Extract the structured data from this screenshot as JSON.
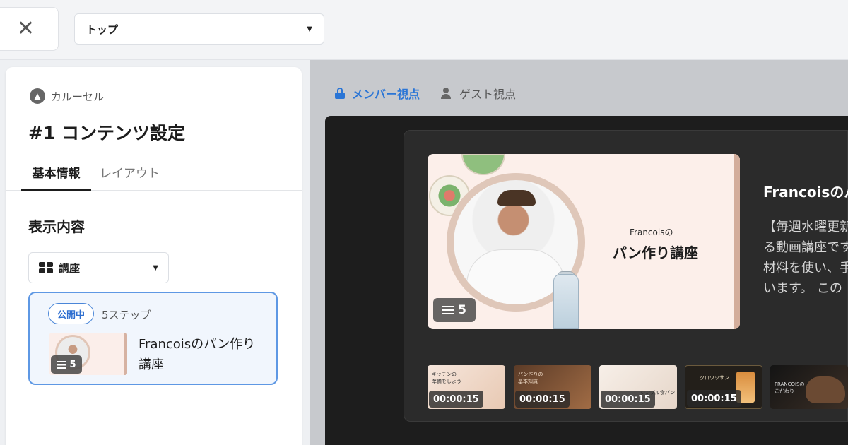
{
  "top_bar": {
    "close_label": "✕",
    "page_select_value": "トップ"
  },
  "panel": {
    "crumb": "カルーセル",
    "title": "#1 コンテンツ設定",
    "tabs": [
      {
        "label": "基本情報",
        "active": true
      },
      {
        "label": "レイアウト",
        "active": false
      }
    ],
    "section_title": "表示内容",
    "content_type": "講座",
    "course": {
      "status_badge": "公開中",
      "steps": "5ステップ",
      "title": "Francoisのパン作り講座",
      "count": "5"
    }
  },
  "preview": {
    "member_view": "メンバー視点",
    "guest_view": "ゲスト視点",
    "hero": {
      "subtitle": "Francoisの",
      "title": "パン作り講座",
      "count": "5"
    },
    "course_name": "Francoisのパ",
    "description_lines": [
      "【毎週水曜更新",
      "る動画講座です",
      "材料を使い、手",
      "います。 この"
    ],
    "thumbnails": [
      {
        "caption": "キッチンの\n準備をしよう",
        "duration": "00:00:15"
      },
      {
        "caption": "パン作りの\n基本知識",
        "duration": "00:00:15"
      },
      {
        "caption": "シンプル食パン",
        "duration": "00:00:15"
      },
      {
        "caption": "クロワッサン",
        "duration": "00:00:15"
      },
      {
        "caption": "FRANCOISの\nこだわり",
        "duration": ""
      }
    ]
  },
  "colors": {
    "accent_blue": "#2a75d6",
    "badge_border": "#4a86d8",
    "stage_bg": "#1d1d1d"
  },
  "icons": {
    "close": "close-icon",
    "dropdown": "chevron-down-icon",
    "crumb": "arrow-up-circle-icon",
    "content_type": "grid-icon",
    "member_view": "lock-icon",
    "guest_view": "person-icon",
    "step_count": "list-icon"
  }
}
